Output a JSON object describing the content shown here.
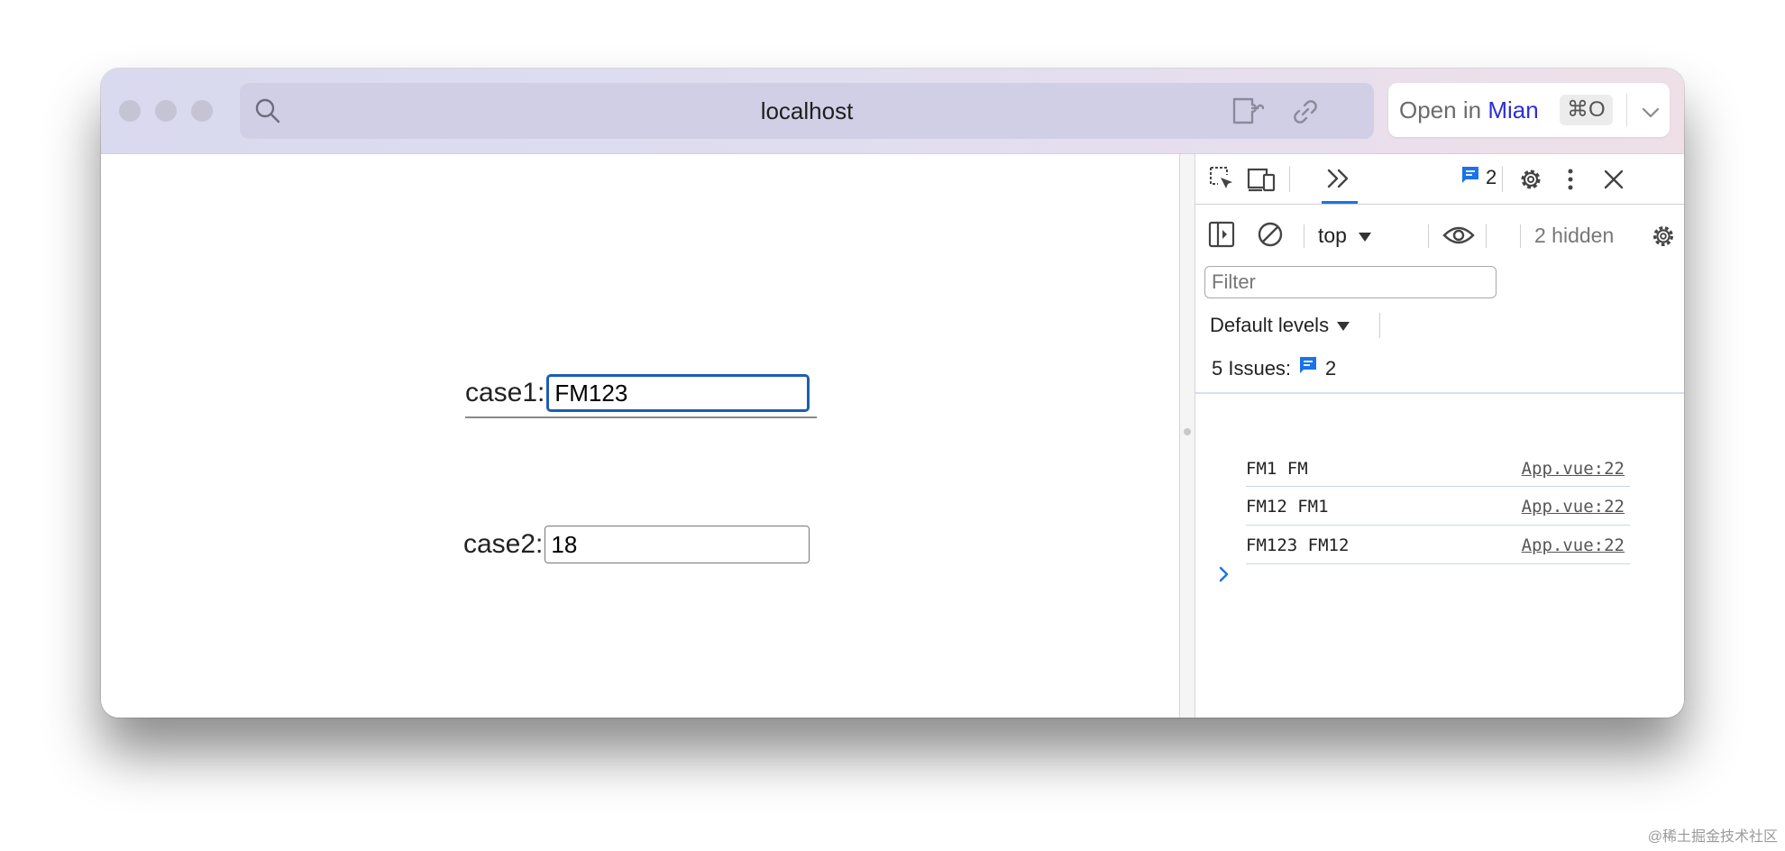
{
  "browser": {
    "url_host": "localhost",
    "open_in": {
      "prefix": "Open in",
      "app": "Mian",
      "shortcut": "⌘O"
    }
  },
  "page": {
    "case1": {
      "label": "case1:",
      "value": "FM123"
    },
    "case2": {
      "label": "case2:",
      "value": "18"
    }
  },
  "devtools": {
    "message_count": "2",
    "context": "top",
    "hidden_label": "2 hidden",
    "filter_placeholder": "Filter",
    "levels_label": "Default levels",
    "issues": {
      "label": "5 Issues:",
      "count": "2"
    },
    "logs": [
      {
        "message": "FM1 FM",
        "source": "App.vue:22"
      },
      {
        "message": "FM12 FM1",
        "source": "App.vue:22"
      },
      {
        "message": "FM123 FM12",
        "source": "App.vue:22"
      }
    ]
  },
  "watermark": "@稀土掘金技术社区",
  "colors": {
    "accent": "#1a73e8",
    "focus_border": "#1a5fb4",
    "brand": "#2b2fd6"
  }
}
